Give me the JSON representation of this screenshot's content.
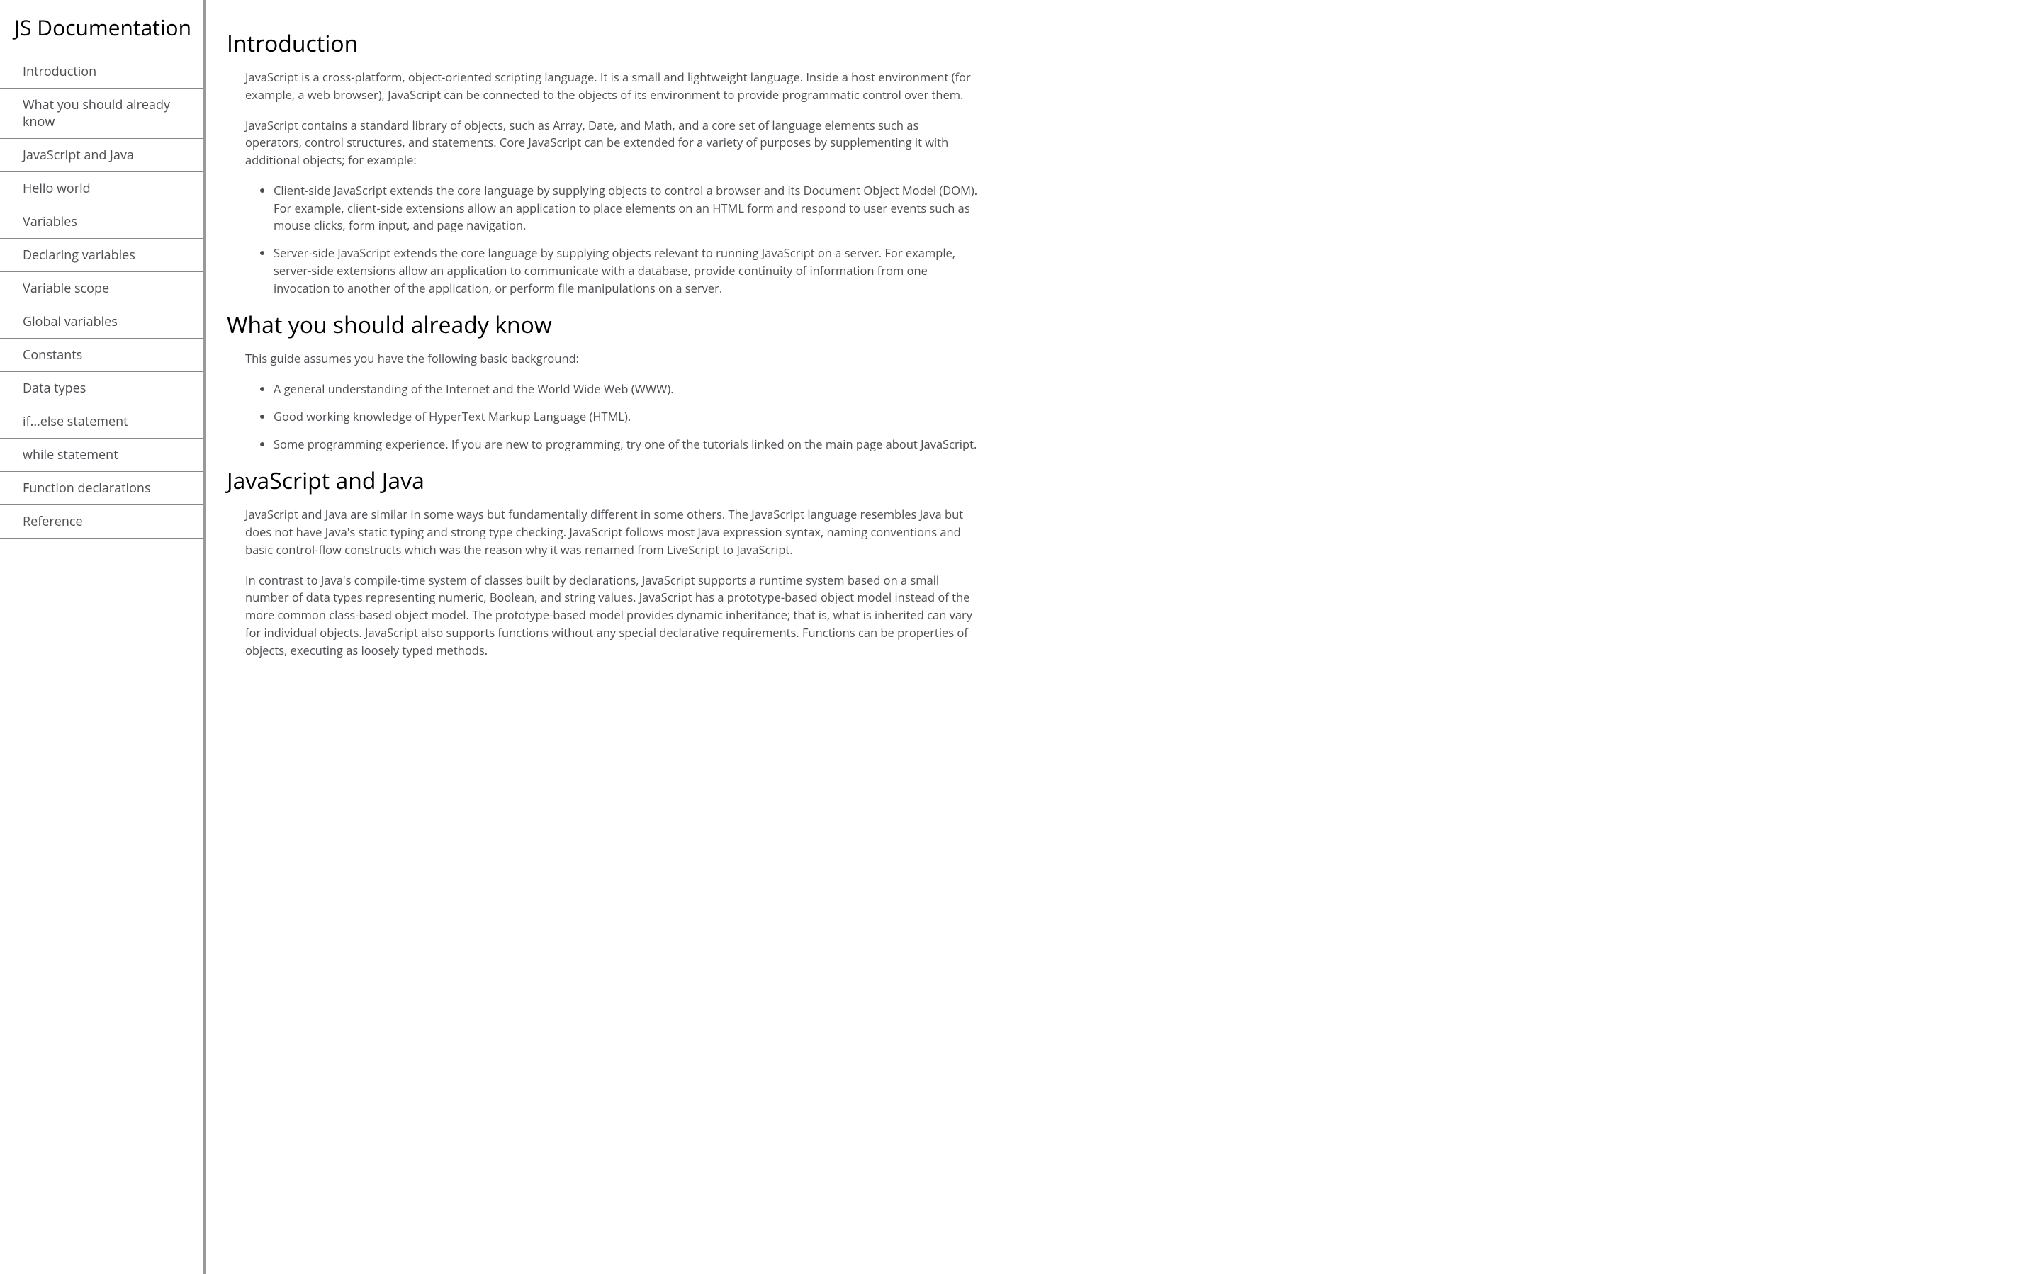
{
  "sidebar": {
    "title": "JS Documentation",
    "items": [
      "Introduction",
      "What you should already know",
      "JavaScript and Java",
      "Hello world",
      "Variables",
      "Declaring variables",
      "Variable scope",
      "Global variables",
      "Constants",
      "Data types",
      "if...else statement",
      "while statement",
      "Function declarations",
      "Reference"
    ]
  },
  "sections": {
    "intro": {
      "title": "Introduction",
      "p1": "JavaScript is a cross-platform, object-oriented scripting language. It is a small and lightweight language. Inside a host environment (for example, a web browser), JavaScript can be connected to the objects of its environment to provide programmatic control over them.",
      "p2": "JavaScript contains a standard library of objects, such as Array, Date, and Math, and a core set of language elements such as operators, control structures, and statements. Core JavaScript can be extended for a variety of purposes by supplementing it with additional objects; for example:",
      "li1": "Client-side JavaScript extends the core language by supplying objects to control a browser and its Document Object Model (DOM). For example, client-side extensions allow an application to place elements on an HTML form and respond to user events such as mouse clicks, form input, and page navigation.",
      "li2": "Server-side JavaScript extends the core language by supplying objects relevant to running JavaScript on a server. For example, server-side extensions allow an application to communicate with a database, provide continuity of information from one invocation to another of the application, or perform file manipulations on a server."
    },
    "know": {
      "title": "What you should already know",
      "p1": "This guide assumes you have the following basic background:",
      "li1": "A general understanding of the Internet and the World Wide Web (WWW).",
      "li2": "Good working knowledge of HyperText Markup Language (HTML).",
      "li3": "Some programming experience. If you are new to programming, try one of the tutorials linked on the main page about JavaScript."
    },
    "jsjava": {
      "title": "JavaScript and Java",
      "p1": "JavaScript and Java are similar in some ways but fundamentally different in some others. The JavaScript language resembles Java but does not have Java's static typing and strong type checking. JavaScript follows most Java expression syntax, naming conventions and basic control-flow constructs which was the reason why it was renamed from LiveScript to JavaScript.",
      "p2": "In contrast to Java's compile-time system of classes built by declarations, JavaScript supports a runtime system based on a small number of data types representing numeric, Boolean, and string values. JavaScript has a prototype-based object model instead of the more common class-based object model. The prototype-based model provides dynamic inheritance; that is, what is inherited can vary for individual objects. JavaScript also supports functions without any special declarative requirements. Functions can be properties of objects, executing as loosely typed methods."
    }
  }
}
